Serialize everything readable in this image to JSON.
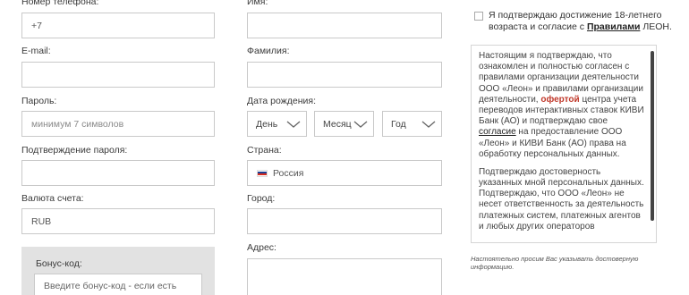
{
  "col1": {
    "phone_label": "Номер телефона:",
    "phone_value": "+7",
    "email_label": "E-mail:",
    "email_value": "",
    "password_label": "Пароль:",
    "password_placeholder": "минимум 7 символов",
    "confirm_label": "Подтверждение пароля:",
    "confirm_value": "",
    "currency_label": "Валюта счета:",
    "currency_value": "RUB",
    "bonus_label": "Бонус-код:",
    "bonus_placeholder": "Введите бонус-код - если есть"
  },
  "col2": {
    "name_label": "Имя:",
    "name_value": "",
    "surname_label": "Фамилия:",
    "surname_value": "",
    "dob_label": "Дата рождения:",
    "day": "День",
    "month": "Месяц",
    "year": "Год",
    "country_label": "Страна:",
    "country_value": "Россия",
    "city_label": "Город:",
    "city_value": "",
    "address_label": "Адрес:",
    "address_value": ""
  },
  "terms": {
    "consent_line1": "Я подтверждаю достижение 18-летнего",
    "consent_line2_prefix": "возраста и согласие с ",
    "consent_link": "Правилами",
    "consent_line2_suffix": " ЛЕОН.",
    "para1_a": "Настоящим я подтверждаю, что ознакомлен и полностью согласен с правилами организации деятельности ООО «Леон» и правилами организации деятельности, ",
    "para1_link1": "офертой",
    "para1_b": " центра учета переводов интерактивных ставок КИВИ Банк (АО) и подтверждаю свое ",
    "para1_link2": "согласие",
    "para1_c": " на предоставление ООО «Леон» и КИВИ Банк (АО) права на обработку персональных данных.",
    "para2": "Подтверждаю достоверность указанных мной персональных данных. Подтверждаю, что ООО «Леон» не несет ответственность за деятельность платежных систем, платежных агентов и любых других операторов",
    "note": "Настоятельно просим Вас указывать достоверную информацию."
  },
  "colors": {
    "panel_bg": "#e2e2e2",
    "border": "#c9c9c9",
    "link_red": "#c0392b",
    "flag": [
      "#ffffff",
      "#1c3f94",
      "#d52b1e"
    ]
  }
}
